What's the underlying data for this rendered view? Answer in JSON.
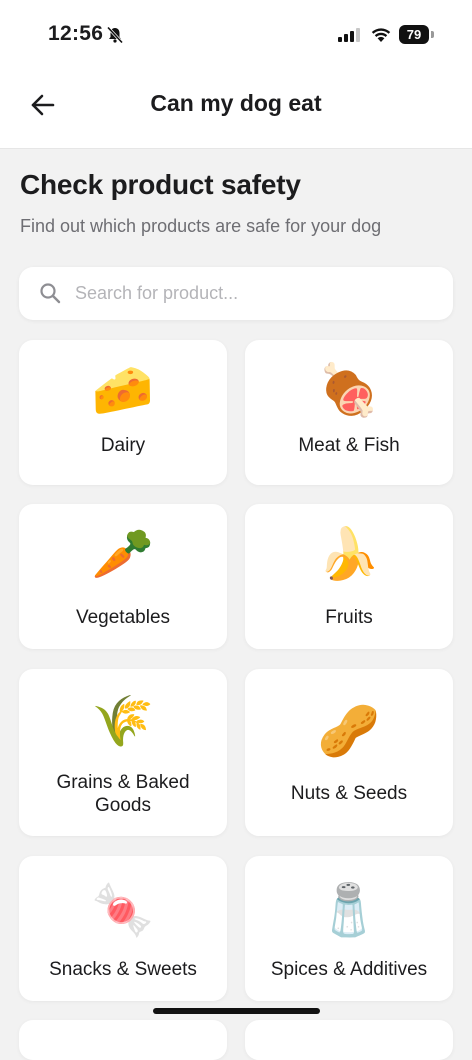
{
  "status_bar": {
    "time": "12:56",
    "battery": "79"
  },
  "nav": {
    "title": "Can my dog eat"
  },
  "header": {
    "title": "Check product safety",
    "subtitle": "Find out which products are safe for your dog"
  },
  "search": {
    "placeholder": "Search for product...",
    "value": ""
  },
  "categories": [
    {
      "label": "Dairy",
      "emoji": "🧀",
      "icon": "cheese-icon"
    },
    {
      "label": "Meat & Fish",
      "emoji": "🍖",
      "icon": "meat-icon"
    },
    {
      "label": "Vegetables",
      "emoji": "🥕",
      "icon": "carrot-icon"
    },
    {
      "label": "Fruits",
      "emoji": "🍌",
      "icon": "banana-icon"
    },
    {
      "label": "Grains & Baked Goods",
      "emoji": "🌾",
      "icon": "grain-icon"
    },
    {
      "label": "Nuts & Seeds",
      "emoji": "🥜",
      "icon": "peanut-icon"
    },
    {
      "label": "Snacks & Sweets",
      "emoji": "🍬",
      "icon": "candy-icon"
    },
    {
      "label": "Spices & Additives",
      "emoji": "🧂",
      "icon": "salt-icon"
    }
  ],
  "colors": {
    "background": "#f2f2f2",
    "card": "#ffffff",
    "text": "#1c1c1e",
    "secondary_text": "#6e6e73",
    "placeholder": "#b4b4b8"
  }
}
